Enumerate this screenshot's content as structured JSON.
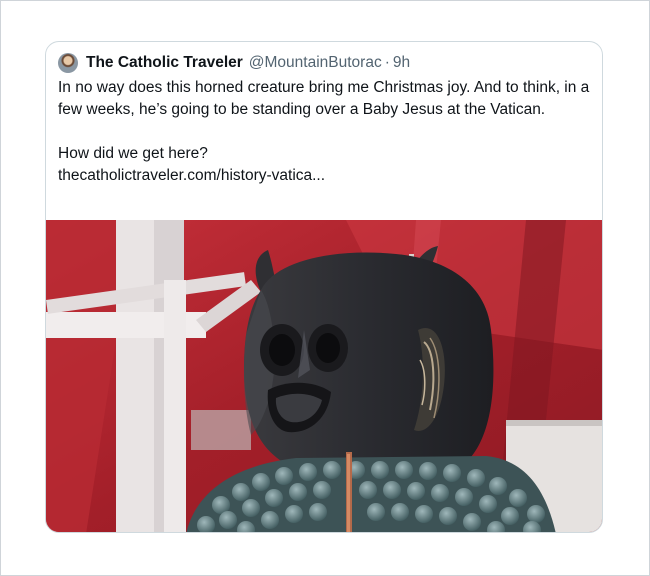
{
  "tweet": {
    "display_name": "The Catholic Traveler",
    "handle": "@MountainButorac",
    "separator": "·",
    "time": "9h",
    "text_line_1": "In no way does this horned creature bring me Christmas joy. And to think, in a few weeks, he’s going to be standing over a Baby Jesus at the Vatican.",
    "text_line_2": "How did we get here?",
    "link": "thecatholictraveler.com/history-vatica..."
  },
  "colors": {
    "text_primary": "#0f1419",
    "text_secondary": "#536471",
    "border": "#cfd9de",
    "background_red": "#b0252c"
  },
  "media": {
    "icon": "photo"
  }
}
